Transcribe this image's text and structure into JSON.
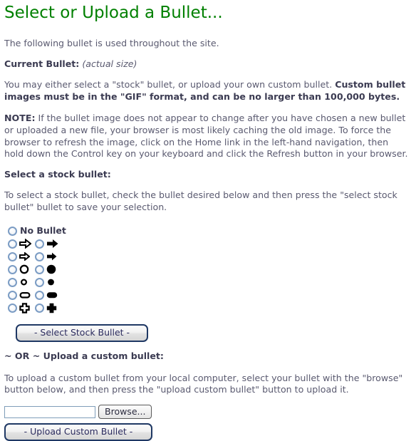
{
  "page": {
    "title": "Select or Upload a Bullet...",
    "title_color": "#008000",
    "intro": "The following bullet is used throughout the site.",
    "current_bullet_label": "Current Bullet:",
    "current_bullet_note": "(actual size)",
    "explain_plain": "You may either select a \"stock\" bullet, or upload your own custom bullet. ",
    "explain_bold": "Custom bullet images must be in the \"GIF\" format, and can be no larger than 100,000 bytes.",
    "note_label": "NOTE:",
    "note_text": " If the bullet image does not appear to change after you have chosen a new bullet or uploaded a new file, your browser is most likely caching the old image. To force the browser to refresh the image, click on the Home link in the left-hand navigation, then hold down the Control key on your keyboard and click the Refresh button in your browser."
  },
  "stock_section": {
    "heading": "Select a stock bullet:",
    "instructions": "To select a stock bullet, check the bullet desired below and then press the \"select stock bullet\" bullet to save your selection.",
    "no_bullet_label": "No Bullet",
    "submit_label": "- Select Stock Bullet -",
    "rows": [
      {
        "left": {
          "icon": "arrow-right-outline-large-icon",
          "selected": false
        },
        "right": {
          "icon": "arrow-right-solid-large-icon",
          "selected": false
        }
      },
      {
        "left": {
          "icon": "arrow-right-outline-small-icon",
          "selected": false
        },
        "right": {
          "icon": "arrow-right-solid-small-icon",
          "selected": false
        }
      },
      {
        "left": {
          "icon": "circle-outline-large-icon",
          "selected": false
        },
        "right": {
          "icon": "circle-solid-large-icon",
          "selected": false
        }
      },
      {
        "left": {
          "icon": "circle-outline-small-icon",
          "selected": false
        },
        "right": {
          "icon": "circle-solid-small-icon",
          "selected": false
        }
      },
      {
        "left": {
          "icon": "rounded-rect-outline-icon",
          "selected": false
        },
        "right": {
          "icon": "rounded-rect-solid-icon",
          "selected": false
        }
      },
      {
        "left": {
          "icon": "cross-outline-icon",
          "selected": false
        },
        "right": {
          "icon": "cross-solid-icon",
          "selected": false
        }
      }
    ]
  },
  "upload_section": {
    "heading": "~ OR ~ Upload a custom bullet:",
    "instructions": "To upload a custom bullet from your local computer, select your bullet with the \"browse\" button below, and then press the \"upload custom bullet\" button to upload it.",
    "file_value": "",
    "file_placeholder": "",
    "browse_label": "Browse...",
    "submit_label": "- Upload Custom Bullet -"
  }
}
